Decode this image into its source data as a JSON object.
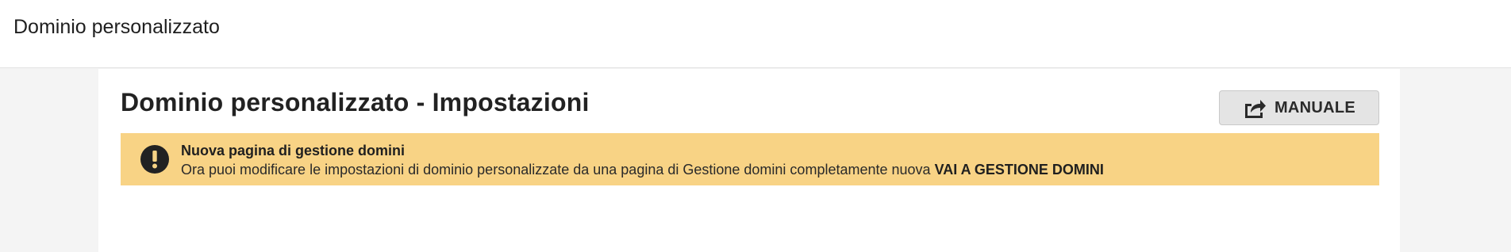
{
  "header": {
    "title": "Dominio personalizzato"
  },
  "main": {
    "heading": "Dominio personalizzato - Impostazioni",
    "manual_button": {
      "label": "MANUALE",
      "icon": "share-arrow-icon"
    },
    "alert": {
      "icon": "exclamation-circle-icon",
      "title": "Nuova pagina di gestione domini",
      "message": "Ora puoi modificare le impostazioni di dominio personalizzate da una pagina di Gestione domini completamente nuova",
      "link_label": "VAI A GESTIONE DOMINI",
      "background_color": "#f8d385"
    }
  },
  "colors": {
    "page_background": "#f4f4f4",
    "panel_background": "#ffffff",
    "button_background": "#e4e4e4"
  }
}
